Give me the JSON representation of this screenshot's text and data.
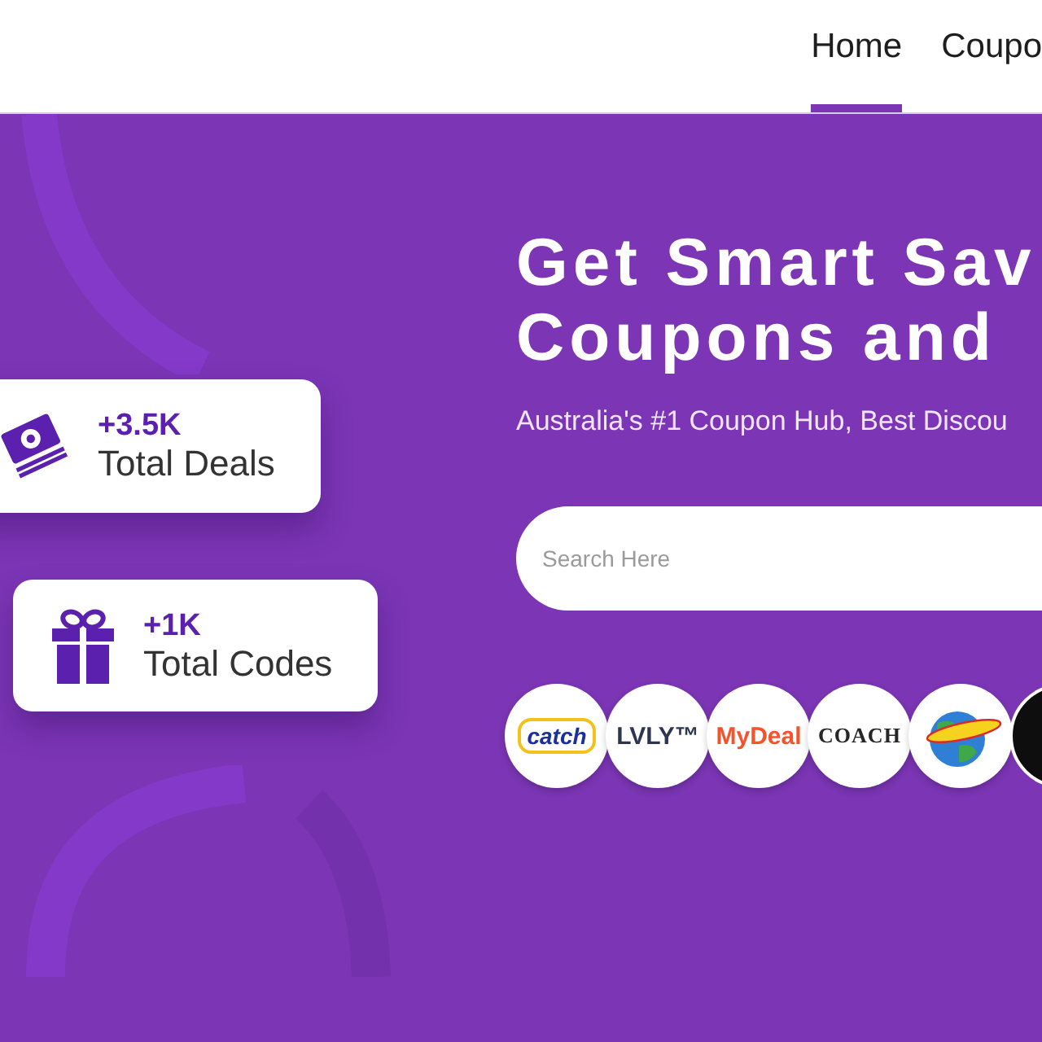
{
  "header": {
    "nav": [
      {
        "label": "Home",
        "selected": true
      },
      {
        "label": "Coupo",
        "selected": false
      }
    ]
  },
  "hero": {
    "title_lines": [
      "Get Smart Sav",
      "Coupons and"
    ],
    "subtitle": "Australia's #1 Coupon Hub, Best Discou",
    "search": {
      "placeholder": "Search Here"
    },
    "stats": [
      {
        "kind": "deals",
        "value": "+3.5K",
        "label": "Total Deals"
      },
      {
        "kind": "codes",
        "value": "+1K",
        "label": "Total Codes"
      }
    ],
    "brands": [
      {
        "kind": "badge",
        "label": "catch"
      },
      {
        "kind": "wordmark",
        "label": "LVLY™",
        "color": "#2e3552"
      },
      {
        "kind": "wordmark",
        "label": "MyDeal",
        "color": "#f2552c"
      },
      {
        "kind": "serif-wordmark",
        "label": "COACH",
        "color": "#262626"
      },
      {
        "kind": "globe"
      },
      {
        "kind": "dark"
      }
    ]
  }
}
